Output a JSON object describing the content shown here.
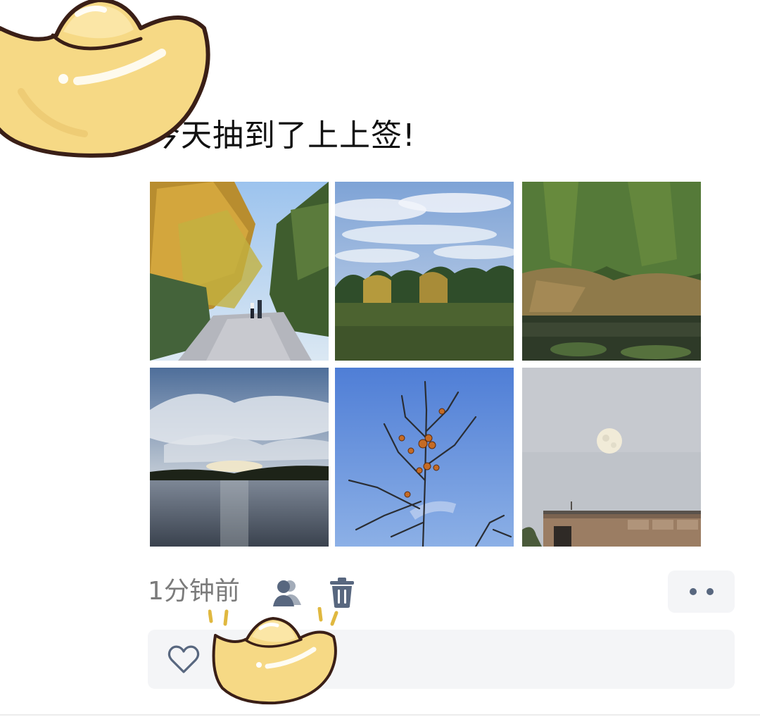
{
  "post": {
    "text": "今天抽到了上上签!",
    "images": [
      {
        "name": "autumn-path-photo"
      },
      {
        "name": "cloudy-meadow-photo"
      },
      {
        "name": "pond-bank-photo"
      },
      {
        "name": "lake-sunset-photo"
      },
      {
        "name": "persimmon-tree-photo"
      },
      {
        "name": "moon-photo"
      }
    ]
  },
  "meta": {
    "time": "1分钟前",
    "visibility_icon": "users-icon",
    "delete_icon": "trash-icon",
    "more_icon": "more-dots-icon"
  },
  "interactions": {
    "like_icon": "heart-outline-icon"
  },
  "colors": {
    "icon_accent": "#58677f",
    "panel_bg": "#f4f5f7",
    "time_text": "#7b7b7b",
    "ingot_fill": "#f6d985",
    "ingot_outline": "#3a1f17"
  }
}
